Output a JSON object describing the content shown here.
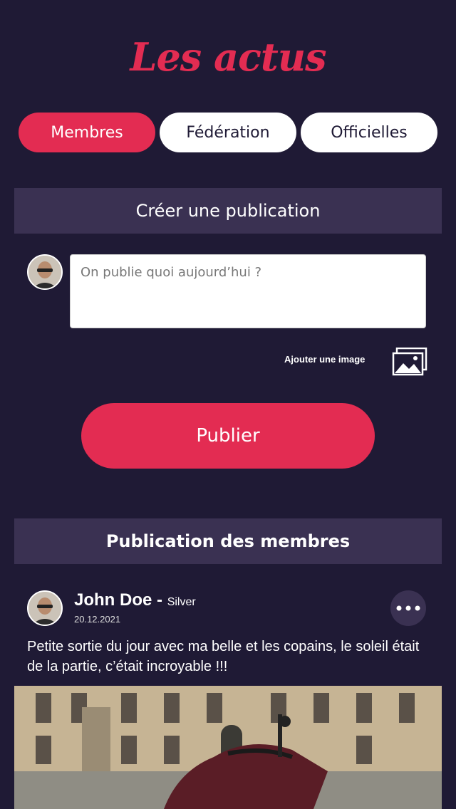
{
  "header": {
    "title": "Les actus"
  },
  "tabs": [
    {
      "label": "Membres",
      "active": true
    },
    {
      "label": "Fédération",
      "active": false
    },
    {
      "label": "Officielles",
      "active": false
    }
  ],
  "create": {
    "header": "Créer une publication",
    "input_placeholder": "On publie quoi aujourd’hui ?",
    "add_image_label": "Ajouter une image",
    "publish_label": "Publier"
  },
  "feed": {
    "header": "Publication des membres",
    "posts": [
      {
        "author": "John Doe",
        "level": "Silver",
        "date": "20.12.2021",
        "text": "Petite sortie du jour avec ma belle et les copains, le soleil était de la partie, c’était incroyable !!!"
      }
    ]
  },
  "colors": {
    "accent": "#e32c52",
    "background": "#1f1a35",
    "header_band": "#3a3152"
  },
  "icons": [
    "image-gallery-icon",
    "more-options-icon"
  ]
}
